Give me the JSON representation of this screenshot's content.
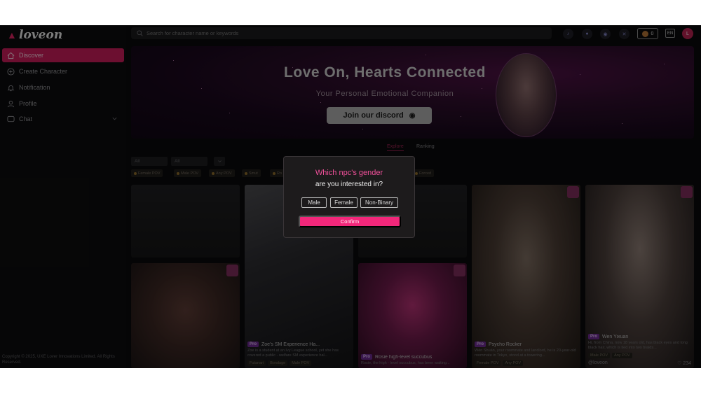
{
  "app": {
    "logo_text": "loveon"
  },
  "sidebar": {
    "items": [
      {
        "label": "Discover",
        "icon": "home-icon"
      },
      {
        "label": "Create Character",
        "icon": "plus-circle-icon"
      },
      {
        "label": "Notification",
        "icon": "bell-icon"
      },
      {
        "label": "Profile",
        "icon": "user-icon"
      },
      {
        "label": "Chat",
        "icon": "chat-icon"
      }
    ],
    "copyright": "Copyright © 2025, UXE Lover Innovations Limited. All Rights Reserved."
  },
  "topbar": {
    "search_placeholder": "Search for character name or keywords",
    "coin_count": "0",
    "language": "EN",
    "avatar_letter": "L",
    "social_icons": [
      "tiktok-icon",
      "discord-icon",
      "reddit-icon",
      "x-icon"
    ]
  },
  "banner": {
    "title": "Love On, Hearts Connected",
    "subtitle": "Your Personal Emotional Companion",
    "button_label": "Join our discord"
  },
  "tabs": [
    {
      "label": "Explore",
      "active": true
    },
    {
      "label": "Ranking",
      "active": false
    }
  ],
  "filters": {
    "selects": [
      "All",
      "All",
      ""
    ],
    "chips": [
      "Female POV",
      "Male POV",
      "Any POV",
      "Smut",
      "Ro",
      "Forced"
    ]
  },
  "cards": [
    {
      "title": "Zoe's SM Experience Ha...",
      "pro": "Pro",
      "desc": "Zoe is a student at an Ivy League school, yet she has covered a public - welfare SM experience hal...",
      "tags": [
        "Futanari",
        "Bondage",
        "Male POV"
      ]
    },
    {
      "title": "Rosie high-level succubus",
      "pro": "Pro",
      "desc": "Rosie, the high - level succubus, has been waiting..."
    },
    {
      "title": "Psycho Rocker",
      "pro": "Pro",
      "desc": "Wén Shuán, your roommate and landlord, he is 20-year-old roommate in Tokyo, stood at a towering...",
      "tags": [
        "Female POV",
        "Any POV"
      ]
    },
    {
      "title": "Wen Yixuan",
      "pro": "Pro",
      "desc": "Hi, from China, now 18 years old, has black eyes and long black hair, which is tied into two braids...",
      "tags": [
        "Male POV",
        "Any POV"
      ],
      "creator": "@loveon",
      "likes": "234"
    }
  ],
  "modal": {
    "title": "Which npc's gender",
    "subtitle": "are you interested in?",
    "options": [
      "Male",
      "Female",
      "Non-Binary"
    ],
    "confirm_label": "Confirm",
    "accent": "#f2277a"
  }
}
